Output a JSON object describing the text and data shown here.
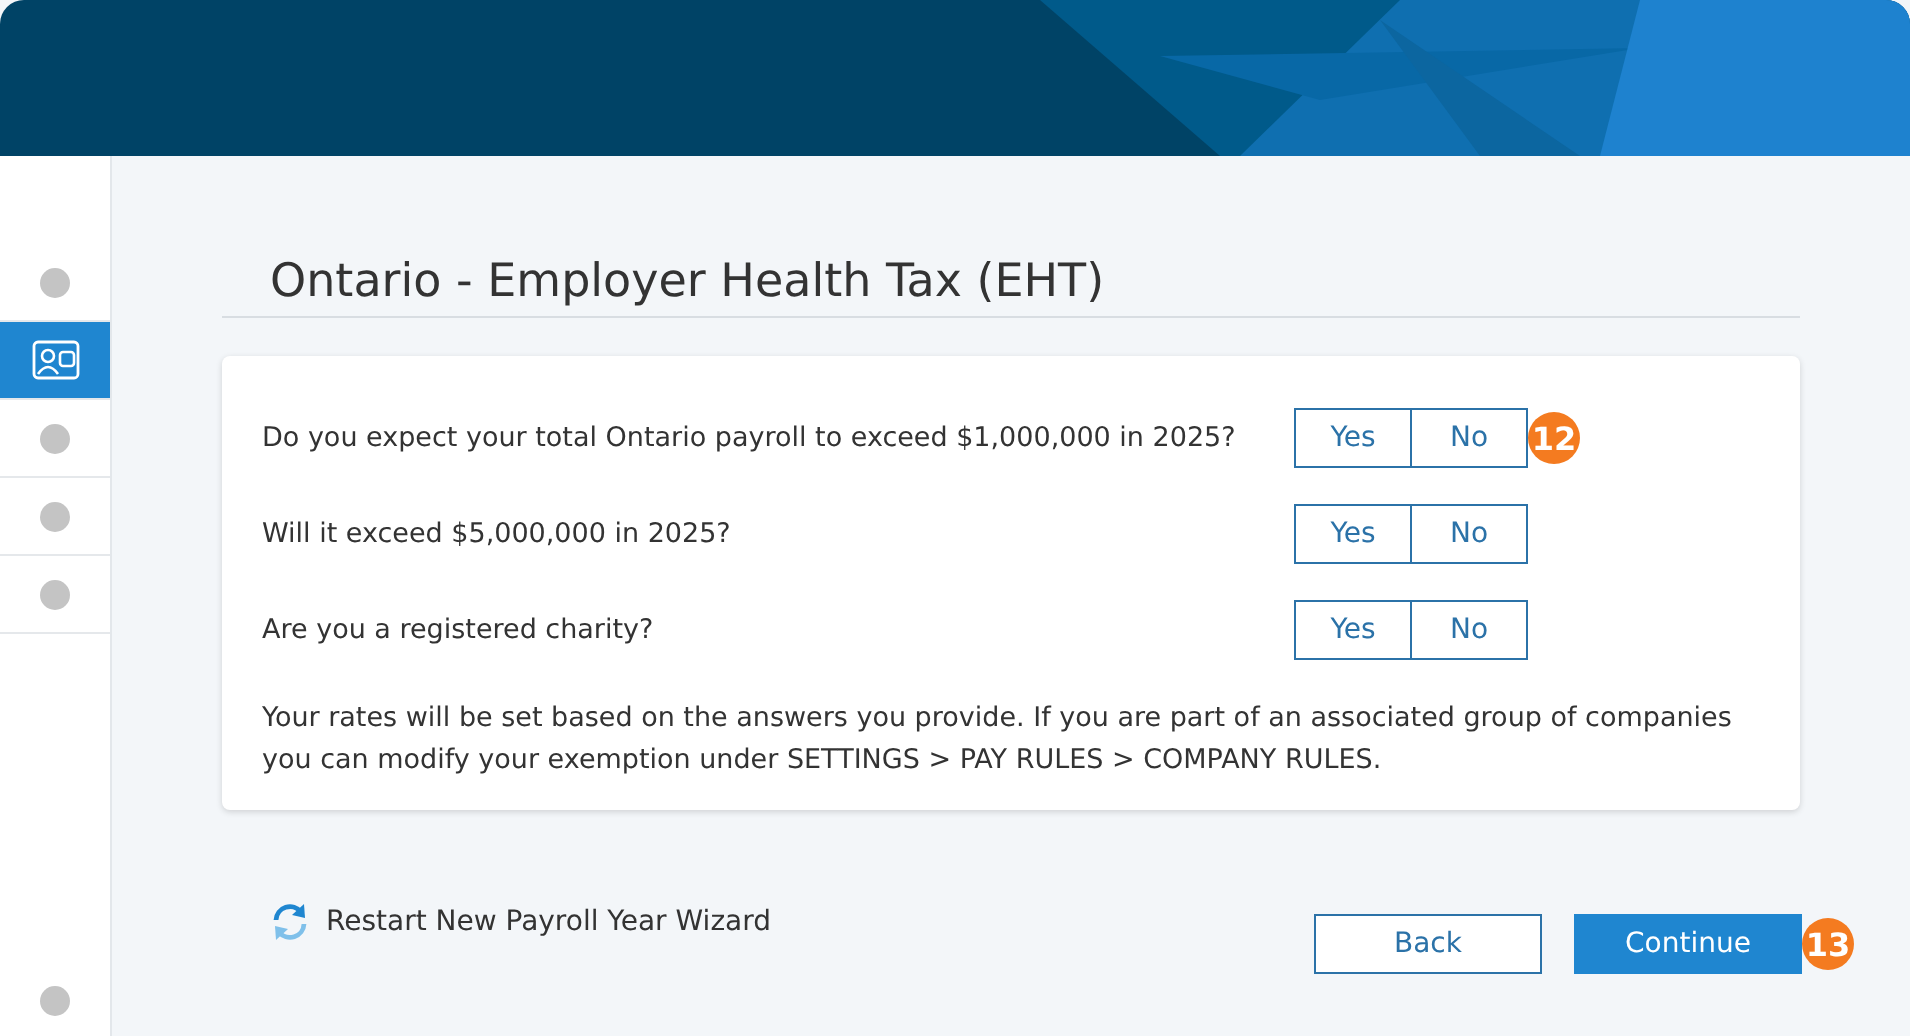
{
  "sidebar": {
    "steps": [
      {
        "kind": "dot",
        "selected": false
      },
      {
        "kind": "icon",
        "selected": true
      },
      {
        "kind": "dot",
        "selected": false
      },
      {
        "kind": "dot",
        "selected": false
      },
      {
        "kind": "dot",
        "selected": false
      }
    ],
    "bottom_step": {
      "kind": "dot",
      "selected": false
    }
  },
  "title": "Ontario - Employer Health Tax (EHT)",
  "questions": [
    {
      "text": "Do you expect your total Ontario payroll to exceed $1,000,000 in 2025?",
      "options": [
        {
          "label": "Yes",
          "selected": false
        },
        {
          "label": "No",
          "selected": false
        }
      ],
      "badge": "12"
    },
    {
      "text": "Will it exceed $5,000,000 in 2025?",
      "options": [
        {
          "label": "Yes",
          "selected": false
        },
        {
          "label": "No",
          "selected": false
        }
      ]
    },
    {
      "text": "Are you a registered charity?",
      "options": [
        {
          "label": "Yes",
          "selected": false
        },
        {
          "label": "No",
          "selected": false
        }
      ]
    }
  ],
  "note": "Your rates will be set based on the answers you provide. If you are part of an associated group of companies you can modify your exemption under SETTINGS > PAY RULES > COMPANY RULES.",
  "restart_link": "Restart New Payroll Year Wizard",
  "back_button": "Back",
  "continue_button": "Continue",
  "continue_badge": "13"
}
